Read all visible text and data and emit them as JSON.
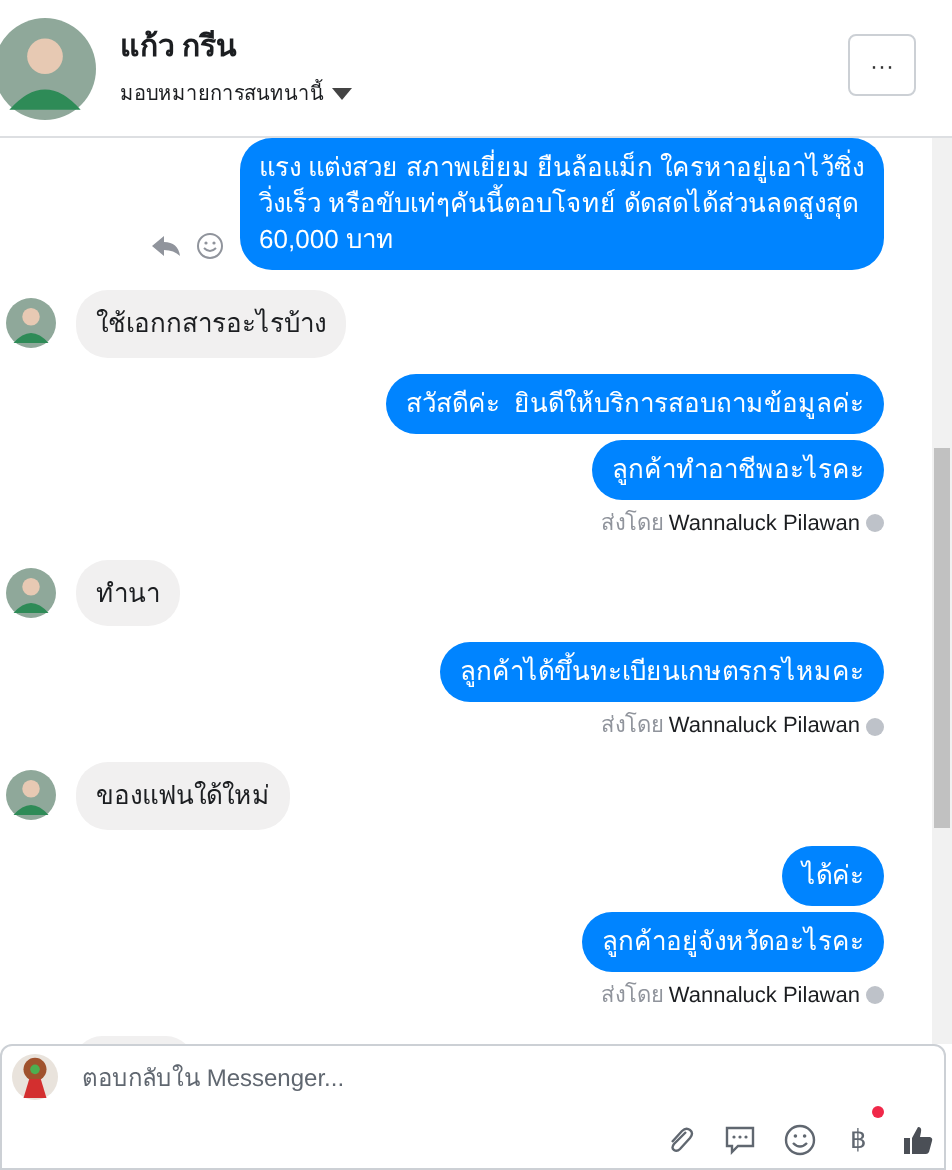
{
  "header": {
    "name": "แก้ว กรีน",
    "assign_label": "มอบหมายการสนทนานี้",
    "more_button": "···"
  },
  "messages": [
    {
      "kind": "outgoing",
      "bubbles": [
        "แรง แต่งสวย สภาพเยี่ยม ยืนล้อแม็ก ใครหาอยู่เอาไว้ซิ่ง\nวิ่งเร็ว หรือขับเท่ๆคันนี้ตอบโจทย์ ดัดสดได้ส่วนลดสูงสุด\n60,000 บาท"
      ],
      "actions": true
    },
    {
      "kind": "incoming",
      "bubbles": [
        "ใช้เอกกสารอะไรบ้าง"
      ]
    },
    {
      "kind": "outgoing",
      "bubbles": [
        "สวัสดีค่ะ  ยินดีให้บริการสอบถามข้อมูลค่ะ",
        "ลูกค้าทำอาชีพอะไรคะ"
      ],
      "sent_by_label": "ส่งโดย",
      "sender": "Wannaluck Pilawan"
    },
    {
      "kind": "incoming",
      "bubbles": [
        "ทำนา"
      ]
    },
    {
      "kind": "outgoing",
      "bubbles": [
        "ลูกค้าได้ขึ้นทะเบียนเกษตรกรไหมคะ"
      ],
      "sent_by_label": "ส่งโดย",
      "sender": "Wannaluck Pilawan"
    },
    {
      "kind": "incoming",
      "bubbles": [
        "ของแฟนใด้ใหม่"
      ]
    },
    {
      "kind": "outgoing",
      "bubbles": [
        "ได้ค่ะ",
        "ลูกค้าอยู่จังหวัดอะไรคะ"
      ],
      "sent_by_label": "ส่งโดย",
      "sender": "Wannaluck Pilawan"
    }
  ],
  "composer": {
    "placeholder": "ตอบกลับใน Messenger...",
    "currency_symbol": "฿",
    "currency_notification": true
  }
}
